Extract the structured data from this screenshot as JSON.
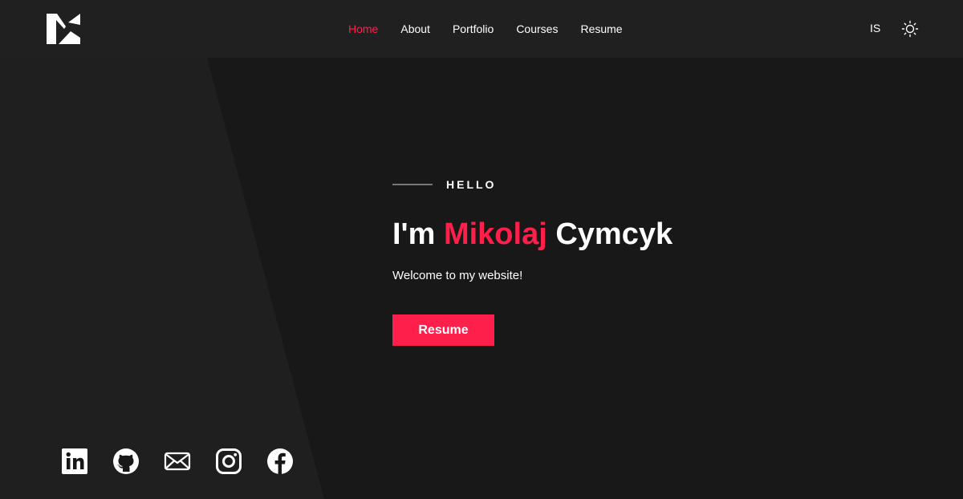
{
  "colors": {
    "accent": "#ff1f4b",
    "navbar": "#202020",
    "background": "#181818",
    "text": "#ffffff"
  },
  "logo": {
    "icon": "mk-monogram-logo"
  },
  "nav": {
    "items": [
      {
        "label": "Home",
        "active": true
      },
      {
        "label": "About"
      },
      {
        "label": "Portfolio"
      },
      {
        "label": "Courses"
      },
      {
        "label": "Resume"
      }
    ],
    "language_label": "IS",
    "theme_icon": "sun-icon"
  },
  "hero": {
    "greeting": "HELLO",
    "headline_prefix": "I'm ",
    "headline_name": "Mikolaj",
    "headline_suffix": " Cymcyk",
    "subtitle": "Welcome to my website!",
    "cta_label": "Resume"
  },
  "socials": [
    {
      "icon": "linkedin-icon"
    },
    {
      "icon": "github-icon"
    },
    {
      "icon": "email-icon"
    },
    {
      "icon": "instagram-icon"
    },
    {
      "icon": "facebook-icon"
    }
  ]
}
